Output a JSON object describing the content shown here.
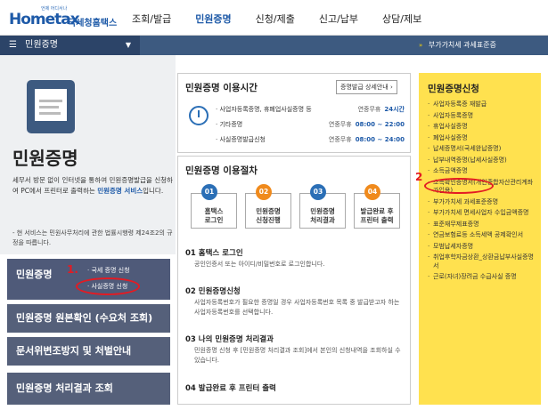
{
  "header": {
    "logo_tag": "언제 어디서나",
    "logo_main": "Hometax",
    "logo_sub": "국세청홈택스",
    "gnb": [
      "조회/발급",
      "민원증명",
      "신청/제출",
      "신고/납부",
      "상담/제보"
    ]
  },
  "navbar": {
    "section_label": "민원증명",
    "notice": "부가가치세 과세표준증"
  },
  "left": {
    "title": "민원증명",
    "desc_pre": "세무서 방문 없이 인터넷을 통하여 민원증명발급을 신청하여 PC에서 프린터로 출력하는 ",
    "desc_highlight": "민원증명 서비스",
    "desc_post": "입니다.",
    "note": "- 현 서비스는 민원사무처리에 관한 법률시행령 제24조2의 규정을 따릅니다.",
    "menu": {
      "item1_title": "민원증명",
      "item1_sub1": "· 국세 증명 신청",
      "item1_sub2": "· 사실증명 신청",
      "item2": "민원증명 원본확인 (수요처 조회)",
      "item3": "문서위변조방지 및 처벌안내",
      "item4": "민원증명 처리결과 조회"
    },
    "annotation": "1."
  },
  "time_box": {
    "title": "민원증명 이용시간",
    "detail_button": "증명발급 상세안내",
    "rows": [
      {
        "label": "· 사업자등록증명, 휴폐업사실증명 등",
        "status": "연중무휴",
        "time": "24시간"
      },
      {
        "label": "· 기타증명",
        "status": "연중무휴",
        "time": "08:00 ~ 22:00"
      },
      {
        "label": "· 사실증명발급신청",
        "status": "연중무휴",
        "time": "08:00 ~ 24:00"
      }
    ]
  },
  "proc_box": {
    "title": "민원증명 이용절차",
    "steps": [
      {
        "num": "01",
        "line1": "홈택스",
        "line2": "로그인",
        "color": "#2b6fb6"
      },
      {
        "num": "02",
        "line1": "민원증명",
        "line2": "신청진행",
        "color": "#f08a1c"
      },
      {
        "num": "03",
        "line1": "민원증명",
        "line2": "처리결과",
        "color": "#2b6fb6"
      },
      {
        "num": "04",
        "line1": "발급완료 후",
        "line2": "프린터 출력",
        "color": "#f08a1c"
      }
    ],
    "details": [
      {
        "title": "01 홈택스 로그인",
        "desc": "공인인증서 또는 아이디/비밀번호로 로그인합니다."
      },
      {
        "title": "02 민원증명신청",
        "desc": "사업자등록번호가 필요한 증명일 경우 사업자등록번호 목록 중 발급받고자 하는 사업자등록번호를 선택합니다."
      },
      {
        "title": "03 나의 민원증명 처리결과",
        "desc": "민원증명 신청 후 [민원증명 처리결과 조회]에서 본인의 신청내역을 조회하실 수 있습니다."
      },
      {
        "title": "04 발급완료 후 프린터 출력",
        "desc": ""
      }
    ]
  },
  "right_panel": {
    "title": "민원증명신청",
    "items": [
      "사업자등록증 재발급",
      "사업자등록증명",
      "휴업사실증명",
      "폐업사실증명",
      "납세증명서(국세완납증명)",
      "납부내역증명(납세사실증명)",
      "소득금액증명",
      "소득확인증명서(개인종합자산관리계좌 가입용)",
      "부가가치세 과세표준증명",
      "부가가치세 면세사업자 수입금액증명",
      "표준재무제표증명",
      "연금보험료등 소득세액 공제확인서",
      "모범납세자증명",
      "취업후학자금상환_상환금납부사실증명서",
      "근로(자녀)장려금 수급사실 증명"
    ],
    "annotation": "2"
  },
  "colors": {
    "nav_bg": "#3d5a80",
    "accent_blue": "#1e5aa8",
    "highlight_yellow": "#ffe14f",
    "annotation_red": "#e31b23"
  }
}
